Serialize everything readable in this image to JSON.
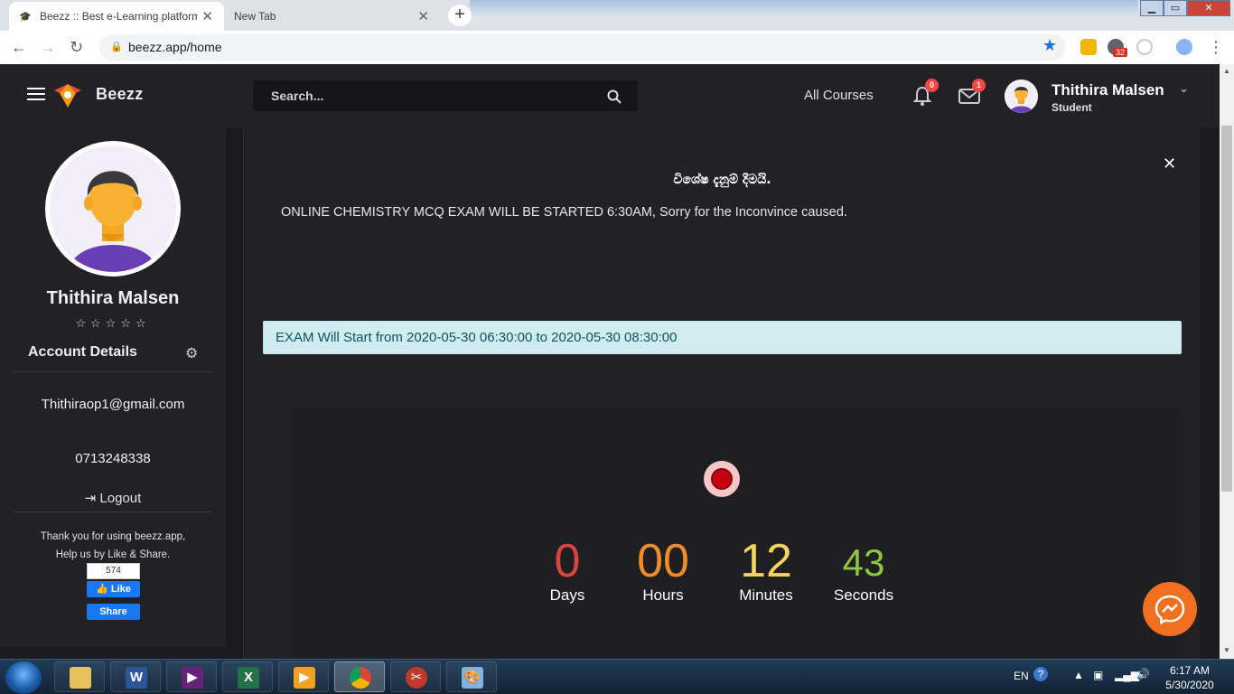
{
  "browser": {
    "tabs": [
      {
        "title": "Beezz :: Best e-Learning platform"
      },
      {
        "title": "New Tab"
      }
    ],
    "url": "beezz.app/home",
    "extension_badge": "32"
  },
  "header": {
    "brand": "Beezz",
    "search_placeholder": "Search...",
    "all_courses": "All Courses",
    "notifications_count": "0",
    "messages_count": "1",
    "user_name": "Thithira Malsen",
    "user_role": "Student"
  },
  "sidebar": {
    "name": "Thithira Malsen",
    "stars": "☆☆☆☆☆",
    "rating_stars_filled": 0,
    "rating_stars_total": 5,
    "account_details": "Account Details",
    "email": "Thithiraop1@gmail.com",
    "phone": "0713248338",
    "logout": "Logout",
    "thanks_line1": "Thank you for using beezz.app,",
    "thanks_line2": "Help us by Like & Share.",
    "fb_count": "574",
    "fb_like": "Like",
    "fb_share": "Share"
  },
  "notice": {
    "title": "විශේෂ දැනුම් දීමයි.",
    "body": "ONLINE CHEMISTRY MCQ EXAM WILL BE STARTED 6:30AM, Sorry for the Inconvince caused."
  },
  "exam": {
    "alert": "EXAM Will Start from 2020-05-30 06:30:00 to 2020-05-30 08:30:00"
  },
  "countdown": {
    "days": "0",
    "days_label": "Days",
    "hours": "00",
    "hours_label": "Hours",
    "minutes": "12",
    "minutes_label": "Minutes",
    "seconds": "43",
    "seconds_label": "Seconds",
    "colors": {
      "days": "#d9443f",
      "hours": "#f08a2c",
      "minutes": "#f4d35e",
      "seconds": "#8dc63f"
    }
  },
  "taskbar": {
    "apps": [
      "explorer-icon",
      "word-icon",
      "visual-studio-icon",
      "excel-icon",
      "media-player-icon",
      "chrome-icon",
      "snipping-tool-icon",
      "paint-icon"
    ],
    "language": "EN",
    "time": "6:17 AM",
    "date": "5/30/2020"
  }
}
